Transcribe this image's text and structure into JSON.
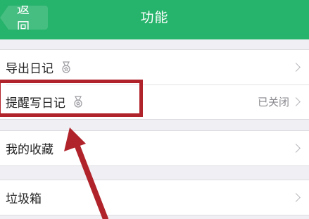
{
  "header": {
    "back_label": "返回",
    "title": "功能",
    "background_color": "#26b36b"
  },
  "groups": [
    {
      "items": [
        {
          "label": "导出日记",
          "icon": "medal-icon",
          "value": ""
        },
        {
          "label": "提醒写日记",
          "icon": "medal-icon",
          "value": "已关闭"
        }
      ]
    },
    {
      "items": [
        {
          "label": "我的收藏",
          "value": ""
        }
      ]
    },
    {
      "items": [
        {
          "label": "垃圾箱",
          "value": ""
        }
      ]
    }
  ],
  "annotation": {
    "color": "#b0232a",
    "highlight_target": "提醒写日记"
  }
}
